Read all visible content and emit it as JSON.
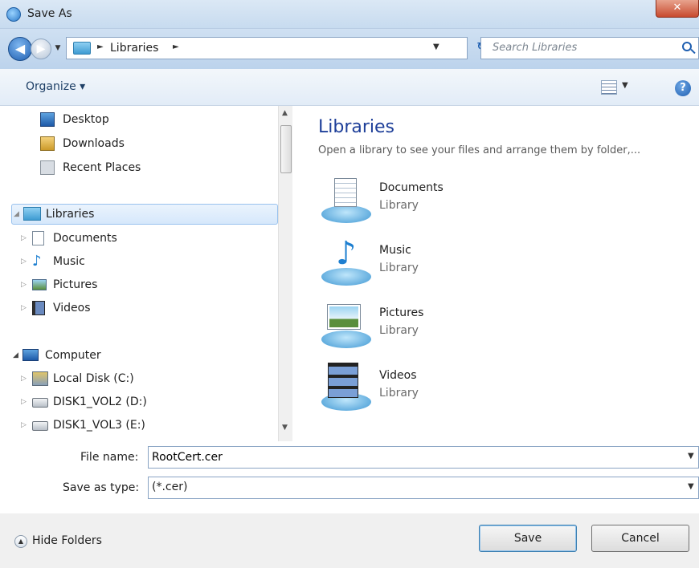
{
  "window": {
    "title": "Save As",
    "close_glyph": "✕"
  },
  "nav_buttons": {
    "back_glyph": "◀",
    "forward_glyph": "▶",
    "dropdown_glyph": "▼"
  },
  "address": {
    "separator": "►",
    "crumb": "Libraries",
    "dropdown_glyph": "▼",
    "refresh_glyph": "↻"
  },
  "search": {
    "placeholder": "Search Libraries"
  },
  "toolbar": {
    "organize_label": "Organize ▾",
    "views_dropdown_glyph": "▼",
    "help_glyph": "?"
  },
  "nav": {
    "favorites": [
      {
        "label": "Desktop",
        "icon": "desktop-icon"
      },
      {
        "label": "Downloads",
        "icon": "downloads-icon"
      },
      {
        "label": "Recent Places",
        "icon": "recent-places-icon"
      }
    ],
    "libraries": {
      "label": "Libraries",
      "expand_glyph": "◢",
      "children": [
        {
          "label": "Documents",
          "icon": "documents-icon"
        },
        {
          "label": "Music",
          "icon": "music-icon"
        },
        {
          "label": "Pictures",
          "icon": "pictures-icon"
        },
        {
          "label": "Videos",
          "icon": "videos-icon"
        }
      ]
    },
    "computer": {
      "label": "Computer",
      "expand_glyph": "◢",
      "children": [
        {
          "label": "Local Disk (C:)",
          "icon": "local-disk-icon"
        },
        {
          "label": "DISK1_VOL2 (D:)",
          "icon": "drive-icon"
        },
        {
          "label": "DISK1_VOL3 (E:)",
          "icon": "drive-icon"
        }
      ]
    },
    "collapsed_glyph": "▷",
    "scroll_up_glyph": "▲",
    "scroll_down_glyph": "▼"
  },
  "content": {
    "heading": "Libraries",
    "subtitle": "Open a library to see your files and arrange them by folder,...",
    "items": [
      {
        "name": "Documents",
        "type": "Library"
      },
      {
        "name": "Music",
        "type": "Library"
      },
      {
        "name": "Pictures",
        "type": "Library"
      },
      {
        "name": "Videos",
        "type": "Library"
      }
    ]
  },
  "form": {
    "filename_label": "File name:",
    "filename_value": "RootCert.cer",
    "savetype_label": "Save as type:",
    "savetype_value": "(*.cer)",
    "dropdown_glyph": "▼"
  },
  "footer": {
    "hide_folders_label": "Hide Folders",
    "hide_folders_glyph": "▲",
    "save_label": "Save",
    "cancel_label": "Cancel"
  }
}
